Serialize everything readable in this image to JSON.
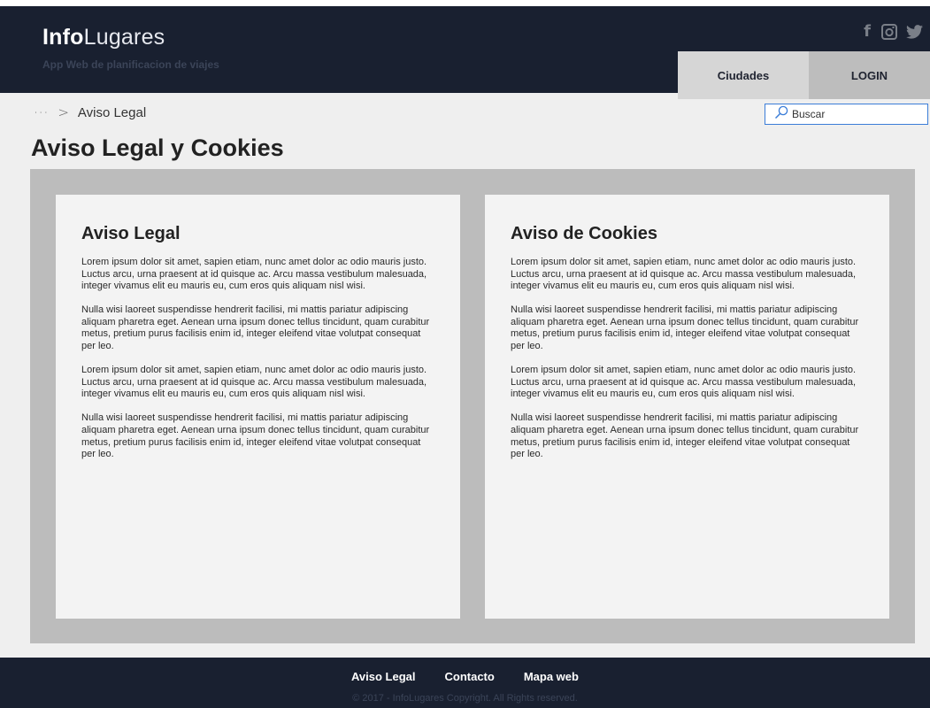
{
  "header": {
    "logo_bold": "Info",
    "logo_light": "Lugares",
    "tagline": "App Web de planificacion de viajes",
    "social": [
      "facebook-icon",
      "instagram-icon",
      "twitter-icon"
    ],
    "nav": {
      "ciudades": "Ciudades",
      "login": "LOGIN"
    }
  },
  "breadcrumb": {
    "more": "···",
    "separator": ">",
    "current": "Aviso Legal"
  },
  "search": {
    "placeholder": "Buscar"
  },
  "page_title": "Aviso Legal y Cookies",
  "cards": [
    {
      "title": "Aviso Legal",
      "paragraphs": [
        "Lorem ipsum dolor sit amet, sapien etiam, nunc amet dolor ac odio mauris justo. Luctus arcu, urna praesent at id quisque ac. Arcu massa vestibulum malesuada, integer vivamus elit eu mauris eu, cum eros quis aliquam nisl wisi.",
        "Nulla wisi laoreet suspendisse hendrerit facilisi, mi mattis pariatur adipiscing aliquam pharetra eget. Aenean urna ipsum donec tellus tincidunt, quam curabitur metus, pretium purus facilisis enim id, integer eleifend vitae volutpat consequat per leo.",
        "Lorem ipsum dolor sit amet, sapien etiam, nunc amet dolor ac odio mauris justo. Luctus arcu, urna praesent at id quisque ac. Arcu massa vestibulum malesuada, integer vivamus elit eu mauris eu, cum eros quis aliquam nisl wisi.",
        "Nulla wisi laoreet suspendisse hendrerit facilisi, mi mattis pariatur adipiscing aliquam pharetra eget. Aenean urna ipsum donec tellus tincidunt, quam curabitur metus, pretium purus facilisis enim id, integer eleifend vitae volutpat consequat per leo."
      ]
    },
    {
      "title": "Aviso de Cookies",
      "paragraphs": [
        "Lorem ipsum dolor sit amet, sapien etiam, nunc amet dolor ac odio mauris justo. Luctus arcu, urna praesent at id quisque ac. Arcu massa vestibulum malesuada, integer vivamus elit eu mauris eu, cum eros quis aliquam nisl wisi.",
        "Nulla wisi laoreet suspendisse hendrerit facilisi, mi mattis pariatur adipiscing aliquam pharetra eget. Aenean urna ipsum donec tellus tincidunt, quam curabitur metus, pretium purus facilisis enim id, integer eleifend vitae volutpat consequat per leo.",
        "Lorem ipsum dolor sit amet, sapien etiam, nunc amet dolor ac odio mauris justo. Luctus arcu, urna praesent at id quisque ac. Arcu massa vestibulum malesuada, integer vivamus elit eu mauris eu, cum eros quis aliquam nisl wisi.",
        "Nulla wisi laoreet suspendisse hendrerit facilisi, mi mattis pariatur adipiscing aliquam pharetra eget. Aenean urna ipsum donec tellus tincidunt, quam curabitur metus, pretium purus facilisis enim id, integer eleifend vitae volutpat consequat per leo."
      ]
    }
  ],
  "footer": {
    "links": [
      "Aviso Legal",
      "Contacto",
      "Mapa web"
    ],
    "copyright": "© 2017 - InfoLugares Copyright. All Rights reserved."
  },
  "colors": {
    "header_bg": "#192030",
    "panel_bg": "#bcbcbc",
    "card_bg": "#f3f3f3",
    "page_bg": "#efefef",
    "search_border": "#3b7dd8"
  }
}
